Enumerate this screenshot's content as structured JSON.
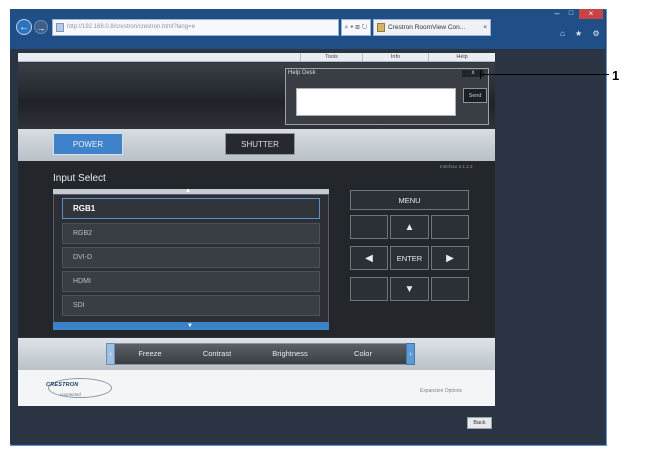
{
  "browser": {
    "address": "http://192.168.0.8/crestron/crestron.html?lang=e",
    "address_tools": "⌕ ▾ ⊠ ↻",
    "tab_title": "Crestron RoomView Con...",
    "tab_close": "×",
    "back_glyph": "←",
    "forward_glyph": "→",
    "min_glyph": "–",
    "max_glyph": "□",
    "close_glyph": "×",
    "toolbar_icons": "⌂ ★ ⚙"
  },
  "topnav": {
    "tools": "Tools",
    "info": "Info",
    "help": "Help"
  },
  "help_desk": {
    "title": "Help Desk",
    "close": "x",
    "send": "Send",
    "message": ""
  },
  "controls": {
    "power": "POWER",
    "shutter": "SHUTTER",
    "version": "Interface 2.1.2.3"
  },
  "input_select": {
    "label": "Input Select",
    "up_arrow": "▲",
    "down_arrow": "▼",
    "items": [
      "RGB1",
      "RGB2",
      "DVI-D",
      "HDMI",
      "SDI"
    ],
    "selected": "RGB1"
  },
  "pad": {
    "menu": "MENU",
    "up": "▲",
    "down": "▼",
    "left": "◀",
    "right": "▶",
    "enter": "ENTER"
  },
  "adjust": {
    "left_arrow": "‹",
    "right_arrow": "›",
    "items": [
      "Freeze",
      "Contrast",
      "Brightness",
      "Color"
    ]
  },
  "footer": {
    "logo_top": "CRESTRON",
    "logo_bottom": "connected",
    "expansion": "Expansion Options",
    "back": "Back"
  },
  "callout": {
    "number": "1"
  }
}
